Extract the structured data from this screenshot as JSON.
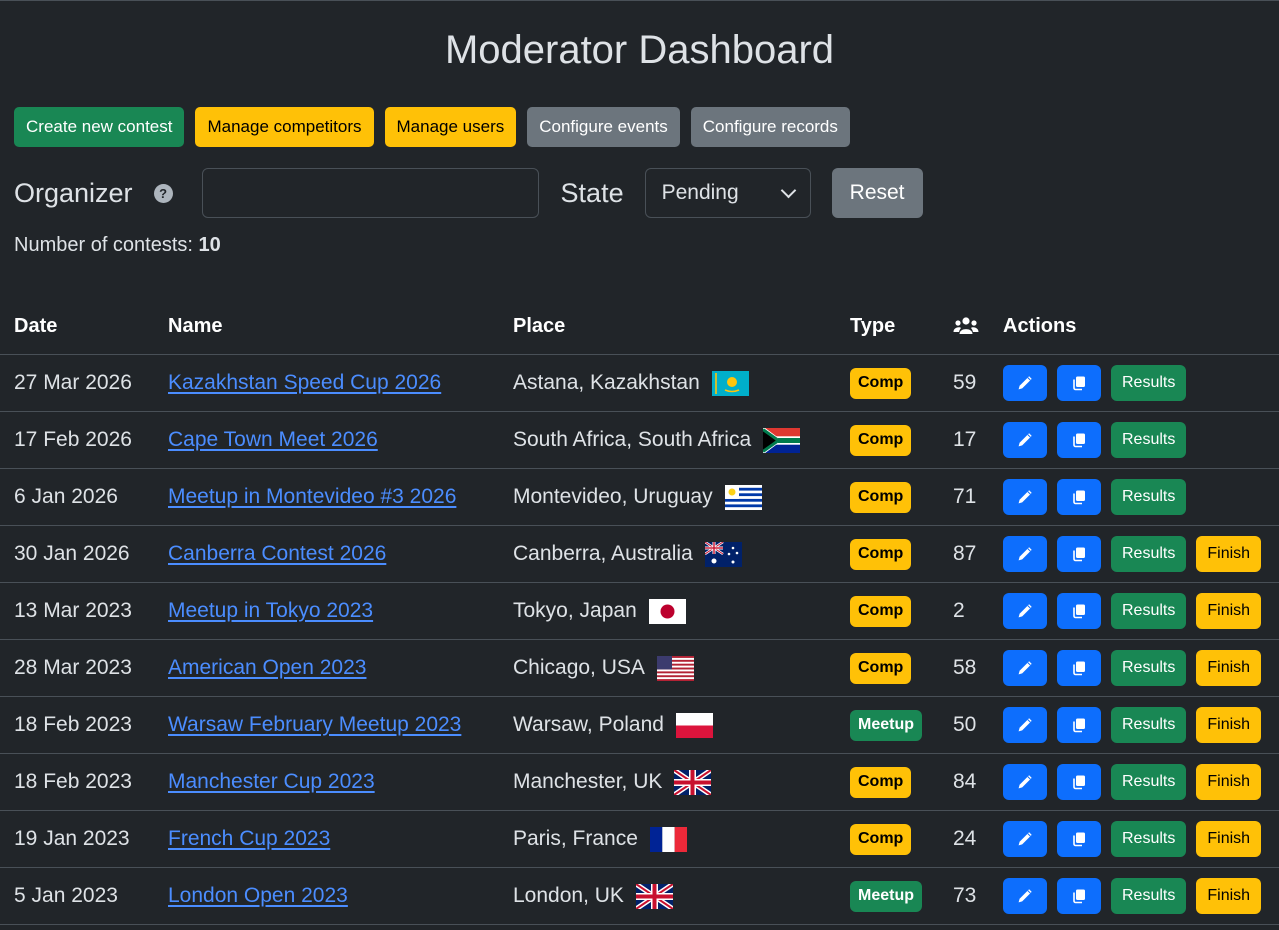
{
  "page": {
    "title": "Moderator Dashboard"
  },
  "buttons": {
    "create": "Create new contest",
    "competitors": "Manage competitors",
    "users": "Manage users",
    "events": "Configure events",
    "records": "Configure records"
  },
  "filters": {
    "organizer_label": "Organizer",
    "organizer_value": "",
    "state_label": "State",
    "state_value": "Pending",
    "reset_label": "Reset"
  },
  "summary": {
    "label": "Number of contests:",
    "count": "10"
  },
  "table": {
    "headers": {
      "date": "Date",
      "name": "Name",
      "place": "Place",
      "type": "Type",
      "actions": "Actions"
    },
    "action_labels": {
      "results": "Results",
      "finish": "Finish"
    },
    "rows": [
      {
        "date": "27 Mar 2026",
        "name": "Kazakhstan Speed Cup 2026",
        "place": "Astana, Kazakhstan",
        "flag": "kz",
        "type": "Comp",
        "competitors": "59",
        "finish": false
      },
      {
        "date": "17 Feb 2026",
        "name": "Cape Town Meet 2026",
        "place": "South Africa, South Africa",
        "flag": "za",
        "type": "Comp",
        "competitors": "17",
        "finish": false
      },
      {
        "date": "6 Jan 2026",
        "name": "Meetup in Montevideo #3 2026",
        "place": "Montevideo, Uruguay",
        "flag": "uy",
        "type": "Comp",
        "competitors": "71",
        "finish": false
      },
      {
        "date": "30 Jan 2026",
        "name": "Canberra Contest 2026",
        "place": "Canberra, Australia",
        "flag": "au",
        "type": "Comp",
        "competitors": "87",
        "finish": true
      },
      {
        "date": "13 Mar 2023",
        "name": "Meetup in Tokyo 2023",
        "place": "Tokyo, Japan",
        "flag": "jp",
        "type": "Comp",
        "competitors": "2",
        "finish": true
      },
      {
        "date": "28 Mar 2023",
        "name": "American Open 2023",
        "place": "Chicago, USA",
        "flag": "us",
        "type": "Comp",
        "competitors": "58",
        "finish": true
      },
      {
        "date": "18 Feb 2023",
        "name": "Warsaw February Meetup 2023",
        "place": "Warsaw, Poland",
        "flag": "pl",
        "type": "Meetup",
        "competitors": "50",
        "finish": true
      },
      {
        "date": "18 Feb 2023",
        "name": "Manchester Cup 2023",
        "place": "Manchester, UK",
        "flag": "gb",
        "type": "Comp",
        "competitors": "84",
        "finish": true
      },
      {
        "date": "19 Jan 2023",
        "name": "French Cup 2023",
        "place": "Paris, France",
        "flag": "fr",
        "type": "Comp",
        "competitors": "24",
        "finish": true
      },
      {
        "date": "5 Jan 2023",
        "name": "London Open 2023",
        "place": "London, UK",
        "flag": "gb",
        "type": "Meetup",
        "competitors": "73",
        "finish": true
      }
    ]
  },
  "colors": {
    "background": "#212529",
    "success": "#198754",
    "warning": "#ffc107",
    "secondary": "#6c757d",
    "primary": "#0d6efd",
    "link": "#4b8dff"
  }
}
